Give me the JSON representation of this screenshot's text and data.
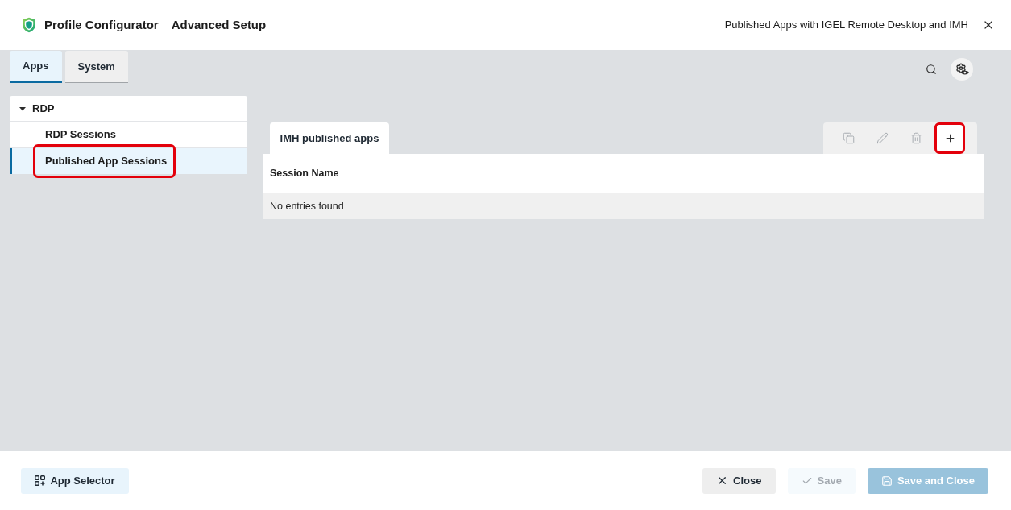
{
  "header": {
    "title": "Profile Configurator",
    "subtitle": "Advanced Setup",
    "context": "Published Apps with IGEL Remote Desktop and IMH"
  },
  "tabs": [
    {
      "label": "Apps",
      "selected": true
    },
    {
      "label": "System",
      "selected": false
    }
  ],
  "sidebar": {
    "groups": [
      {
        "label": "RDP",
        "expanded": true,
        "children": [
          {
            "label": "RDP Sessions",
            "selected": false,
            "highlighted": false
          },
          {
            "label": "Published App Sessions",
            "selected": true,
            "highlighted": true
          }
        ]
      }
    ]
  },
  "panel": {
    "tabs": [
      {
        "label": "IMH published apps",
        "selected": true
      }
    ],
    "toolbar": [
      {
        "kind": "copy",
        "disabled": true,
        "highlighted": false
      },
      {
        "kind": "edit",
        "disabled": true,
        "highlighted": false
      },
      {
        "kind": "delete",
        "disabled": true,
        "highlighted": false
      },
      {
        "kind": "add",
        "disabled": false,
        "highlighted": true
      }
    ],
    "table": {
      "columns": [
        "Session Name"
      ],
      "empty_text": "No entries found"
    }
  },
  "footer": {
    "buttons": [
      {
        "kind": "app-selector",
        "label": "App Selector",
        "disabled": false
      },
      {
        "kind": "close",
        "label": "Close",
        "disabled": false
      },
      {
        "kind": "save",
        "label": "Save",
        "disabled": true
      },
      {
        "kind": "save-close",
        "label": "Save and Close",
        "disabled": true
      }
    ]
  }
}
